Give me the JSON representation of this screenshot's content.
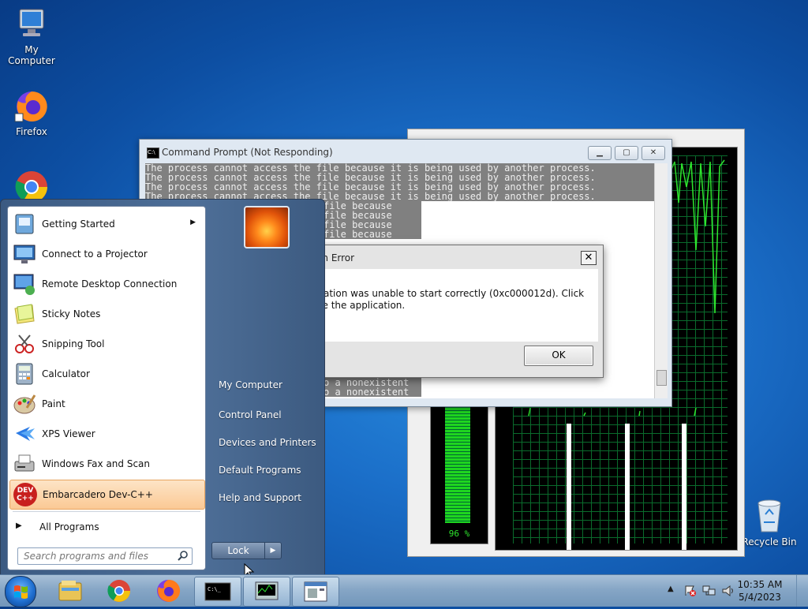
{
  "desktop": {
    "icons": [
      {
        "label": "My Computer",
        "icon": "computer-icon"
      },
      {
        "label": "Firefox",
        "icon": "firefox-icon"
      },
      {
        "label": "Recycle Bin",
        "icon": "recycle-bin-icon"
      }
    ]
  },
  "cmd_window": {
    "title": "Command Prompt (Not Responding)",
    "lines": [
      "The process cannot access the file because it is being used by another process.",
      "The process cannot access the file because it is being used by another process.",
      "The process cannot access the file because it is being used by another process.",
      "The process cannot access the file because it is being used by another process."
    ],
    "partial_lines": [
      "file because",
      "file because",
      "file because",
      "file because"
    ],
    "bottom_lines": [
      "o a nonexistent",
      "o a nonexistent"
    ]
  },
  "error_dialog": {
    "title": "cmd.exe - Application Error",
    "message": "The application was unable to start correctly (0xc000012d). Click OK to close the application.",
    "ok_label": "OK",
    "close_label": "✕"
  },
  "task_manager": {
    "cpu_usage_label": "96 %",
    "cpu_usage_fraction": 0.96
  },
  "start_menu": {
    "programs": [
      {
        "label": "Getting Started",
        "icon": "getting-started-icon",
        "has_submenu": true
      },
      {
        "label": "Connect to a Projector",
        "icon": "projector-icon"
      },
      {
        "label": "Remote Desktop Connection",
        "icon": "remote-desktop-icon"
      },
      {
        "label": "Sticky Notes",
        "icon": "sticky-notes-icon"
      },
      {
        "label": "Snipping Tool",
        "icon": "snipping-tool-icon"
      },
      {
        "label": "Calculator",
        "icon": "calculator-icon"
      },
      {
        "label": "Paint",
        "icon": "paint-icon"
      },
      {
        "label": "XPS Viewer",
        "icon": "xps-viewer-icon"
      },
      {
        "label": "Windows Fax and Scan",
        "icon": "fax-scan-icon"
      },
      {
        "label": "Embarcadero Dev-C++",
        "icon": "devcpp-icon",
        "highlighted": true
      }
    ],
    "all_programs": "All Programs",
    "search_placeholder": "Search programs and files",
    "right_items": [
      "My Computer",
      "Control Panel",
      "Devices and Printers",
      "Default Programs",
      "Help and Support"
    ],
    "lock_label": "Lock",
    "lock_arrow": "▶",
    "devcpp_icon_text": "DEV\nC++"
  },
  "taskbar": {
    "clock_time": "10:35 AM",
    "clock_date": "5/4/2023",
    "buttons": [
      "start-orb",
      "explorer",
      "chrome",
      "firefox",
      "cmd",
      "task-manager",
      "notepad"
    ]
  }
}
